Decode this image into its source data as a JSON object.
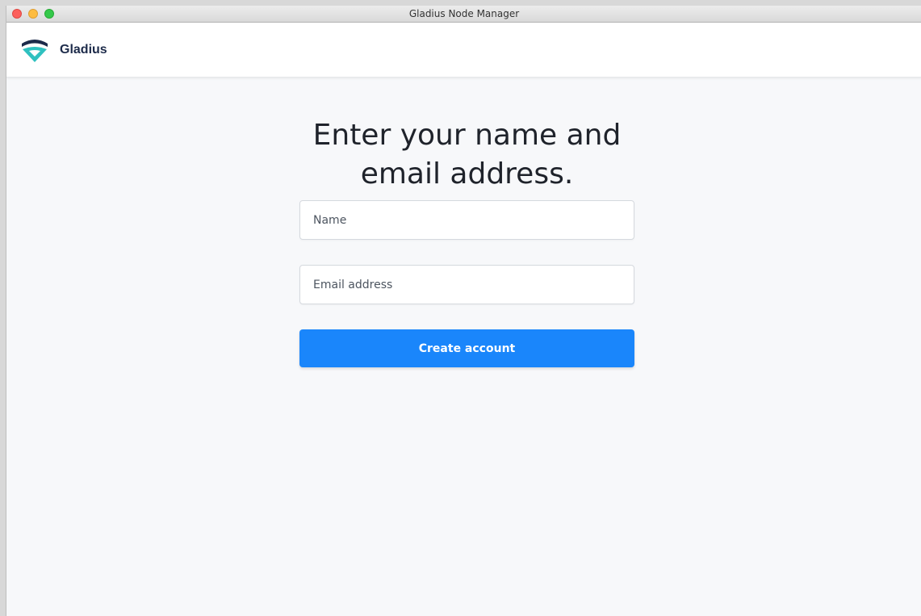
{
  "window": {
    "title": "Gladius Node Manager"
  },
  "header": {
    "logo_icon": "gladius-shield-logo",
    "brand_name": "Gladius",
    "brand_colors": {
      "navy": "#1d2b4a",
      "teal": "#2fc1c0"
    }
  },
  "form": {
    "heading_line1": "Enter your name and",
    "heading_line2": "email address.",
    "name_placeholder": "Name",
    "name_value": "",
    "email_placeholder": "Email address",
    "email_value": "",
    "submit_label": "Create account",
    "accent_color": "#1a86fb"
  }
}
